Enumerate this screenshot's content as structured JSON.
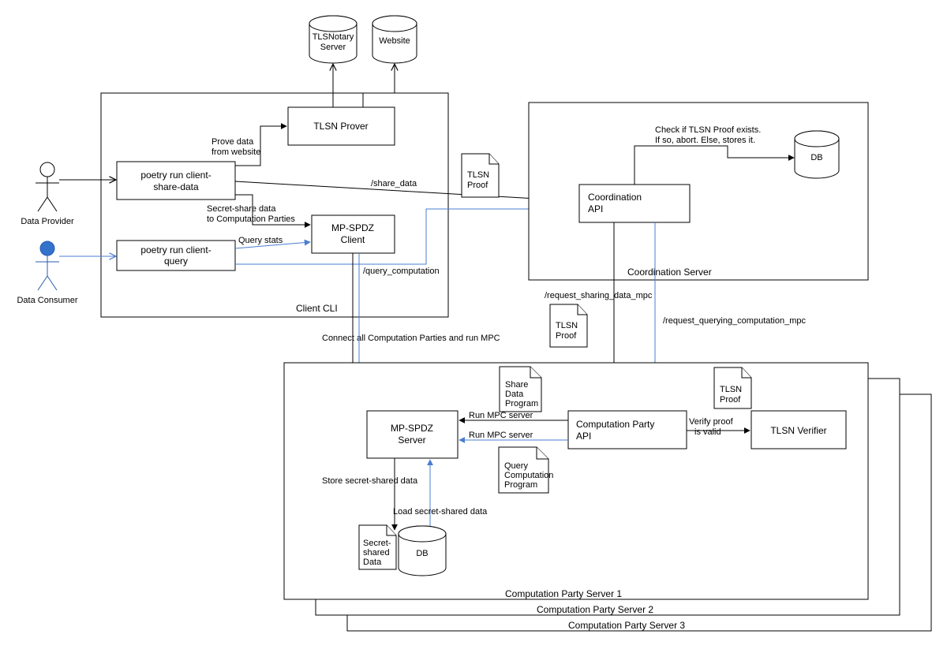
{
  "actors": {
    "provider": "Data Provider",
    "consumer": "Data Consumer"
  },
  "client_cli": {
    "label": "Client CLI",
    "share_cmd": "poetry run client-share-data",
    "query_cmd": "poetry run client-query",
    "tlsn_prover": "TLSN Prover",
    "prove_label1": "Prove data",
    "prove_label2": "from website",
    "secret_share1": "Secret-share data",
    "secret_share2": "to Computation Parties",
    "query_stats": "Query stats",
    "mpspdz_client1": "MP-SPDZ",
    "mpspdz_client2": "Client",
    "share_data_ep": "/share_data",
    "query_comp_ep": "/query_computation"
  },
  "top_db": {
    "tlsnotary1": "TLSNotary",
    "tlsnotary2": "Server",
    "website": "Website"
  },
  "docs": {
    "tlsn_proof1": "TLSN",
    "tlsn_proof2": "Proof",
    "share_data1": "Share",
    "share_data2": "Data",
    "share_data3": "Program",
    "query_comp1": "Query",
    "query_comp2": "Computation",
    "query_comp3": "Program",
    "secret_shared1": "Secret-",
    "secret_shared2": "shared",
    "secret_shared3": "Data"
  },
  "coord": {
    "label": "Coordination Server",
    "api1": "Coordination",
    "api2": "API",
    "check1": "Check if TLSN Proof exists.",
    "check2": "If so, abort. Else, stores it.",
    "db": "DB",
    "req_share": "/request_sharing_data_mpc",
    "req_query": "/request_querying_computation_mpc"
  },
  "mpc": {
    "connect_all": "Connect all Computation Parties and run MPC"
  },
  "cps": {
    "server1": "Computation Party Server 1",
    "server2": "Computation Party Server 2",
    "server3": "Computation Party Server 3",
    "api1": "Computation Party",
    "api2": "API",
    "mpspdz1": "MP-SPDZ",
    "mpspdz2": "Server",
    "run_mpc_b": "Run MPC server",
    "run_mpc_q": "Run MPC server",
    "verify1": "Verify proof",
    "verify2": "is valid",
    "tlsn_verifier": "TLSN Verifier",
    "store_secret": "Store secret-shared data",
    "load_secret": "Load secret-shared data",
    "db": "DB"
  }
}
